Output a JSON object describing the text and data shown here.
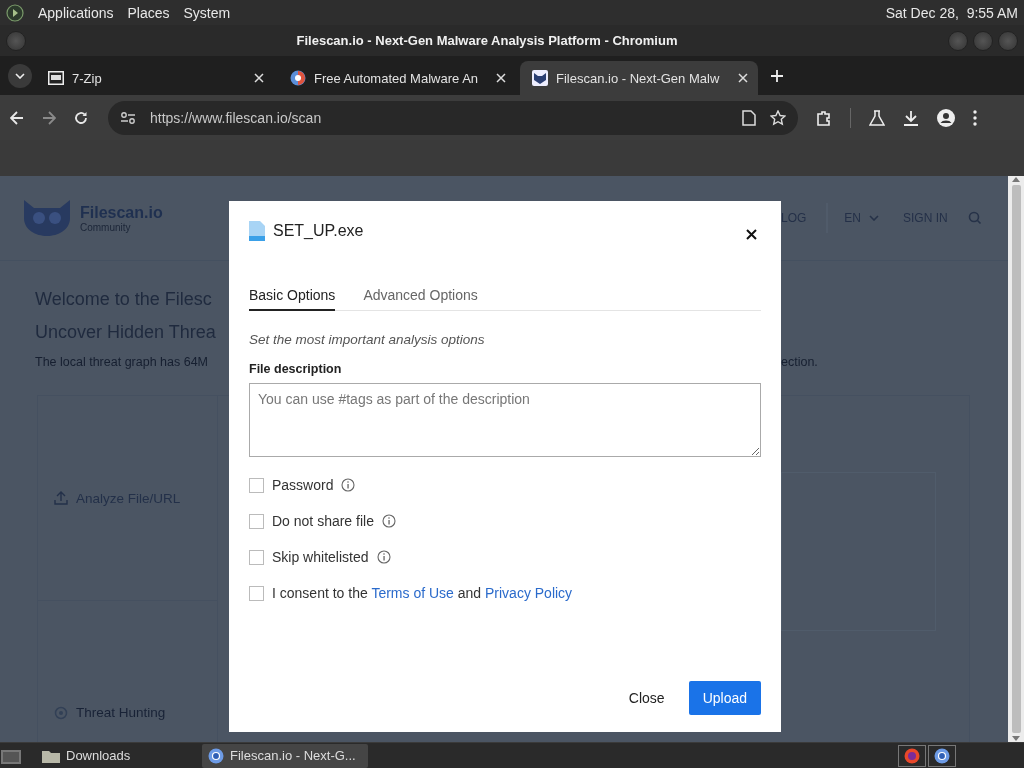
{
  "top_panel": {
    "menus": [
      "Applications",
      "Places",
      "System"
    ],
    "clock": "Sat Dec 28,  9:55 AM"
  },
  "window": {
    "title": "Filescan.io - Next-Gen Malware Analysis Platform - Chromium"
  },
  "tabs": [
    {
      "title": "7-Zip",
      "selected": false
    },
    {
      "title": "Free Automated Malware An",
      "selected": false
    },
    {
      "title": "Filescan.io - Next-Gen Malw",
      "selected": true
    }
  ],
  "address_bar": {
    "url": "https://www.filescan.io/scan"
  },
  "page": {
    "logo": "Filescan.io",
    "logo_subtitle": "Community",
    "nav": [
      "LOG",
      "EN",
      "SIGN IN"
    ],
    "headline_1": "Welcome to the Filesc",
    "headline_2": "Uncover Hidden Threa",
    "intro": "The local threat graph has 64M",
    "intro_end": "ection.",
    "menu": [
      "Analyze File/URL",
      "Threat Hunting"
    ]
  },
  "dialog": {
    "file_name": "SET_UP.exe",
    "tabs": [
      {
        "label": "Basic Options",
        "selected": true
      },
      {
        "label": "Advanced Options",
        "selected": false
      }
    ],
    "hint": "Set the most important analysis options",
    "field_label": "File description",
    "placeholder": "You can use #tags as part of the description",
    "options": [
      {
        "label": "Password",
        "checked": false
      },
      {
        "label": "Do not share file",
        "checked": false
      },
      {
        "label": "Skip whitelisted",
        "checked": false
      }
    ],
    "consent": {
      "checked": false,
      "prefix": "I consent to the",
      "link_1": "Terms of Use",
      "middle": "and",
      "link_2": "Privacy Policy"
    },
    "buttons": [
      "Close",
      "Upload"
    ]
  },
  "taskbar": {
    "items": [
      {
        "label": "Downloads",
        "selected": false
      },
      {
        "label": "Filescan.io - Next-G...",
        "selected": true
      }
    ]
  }
}
